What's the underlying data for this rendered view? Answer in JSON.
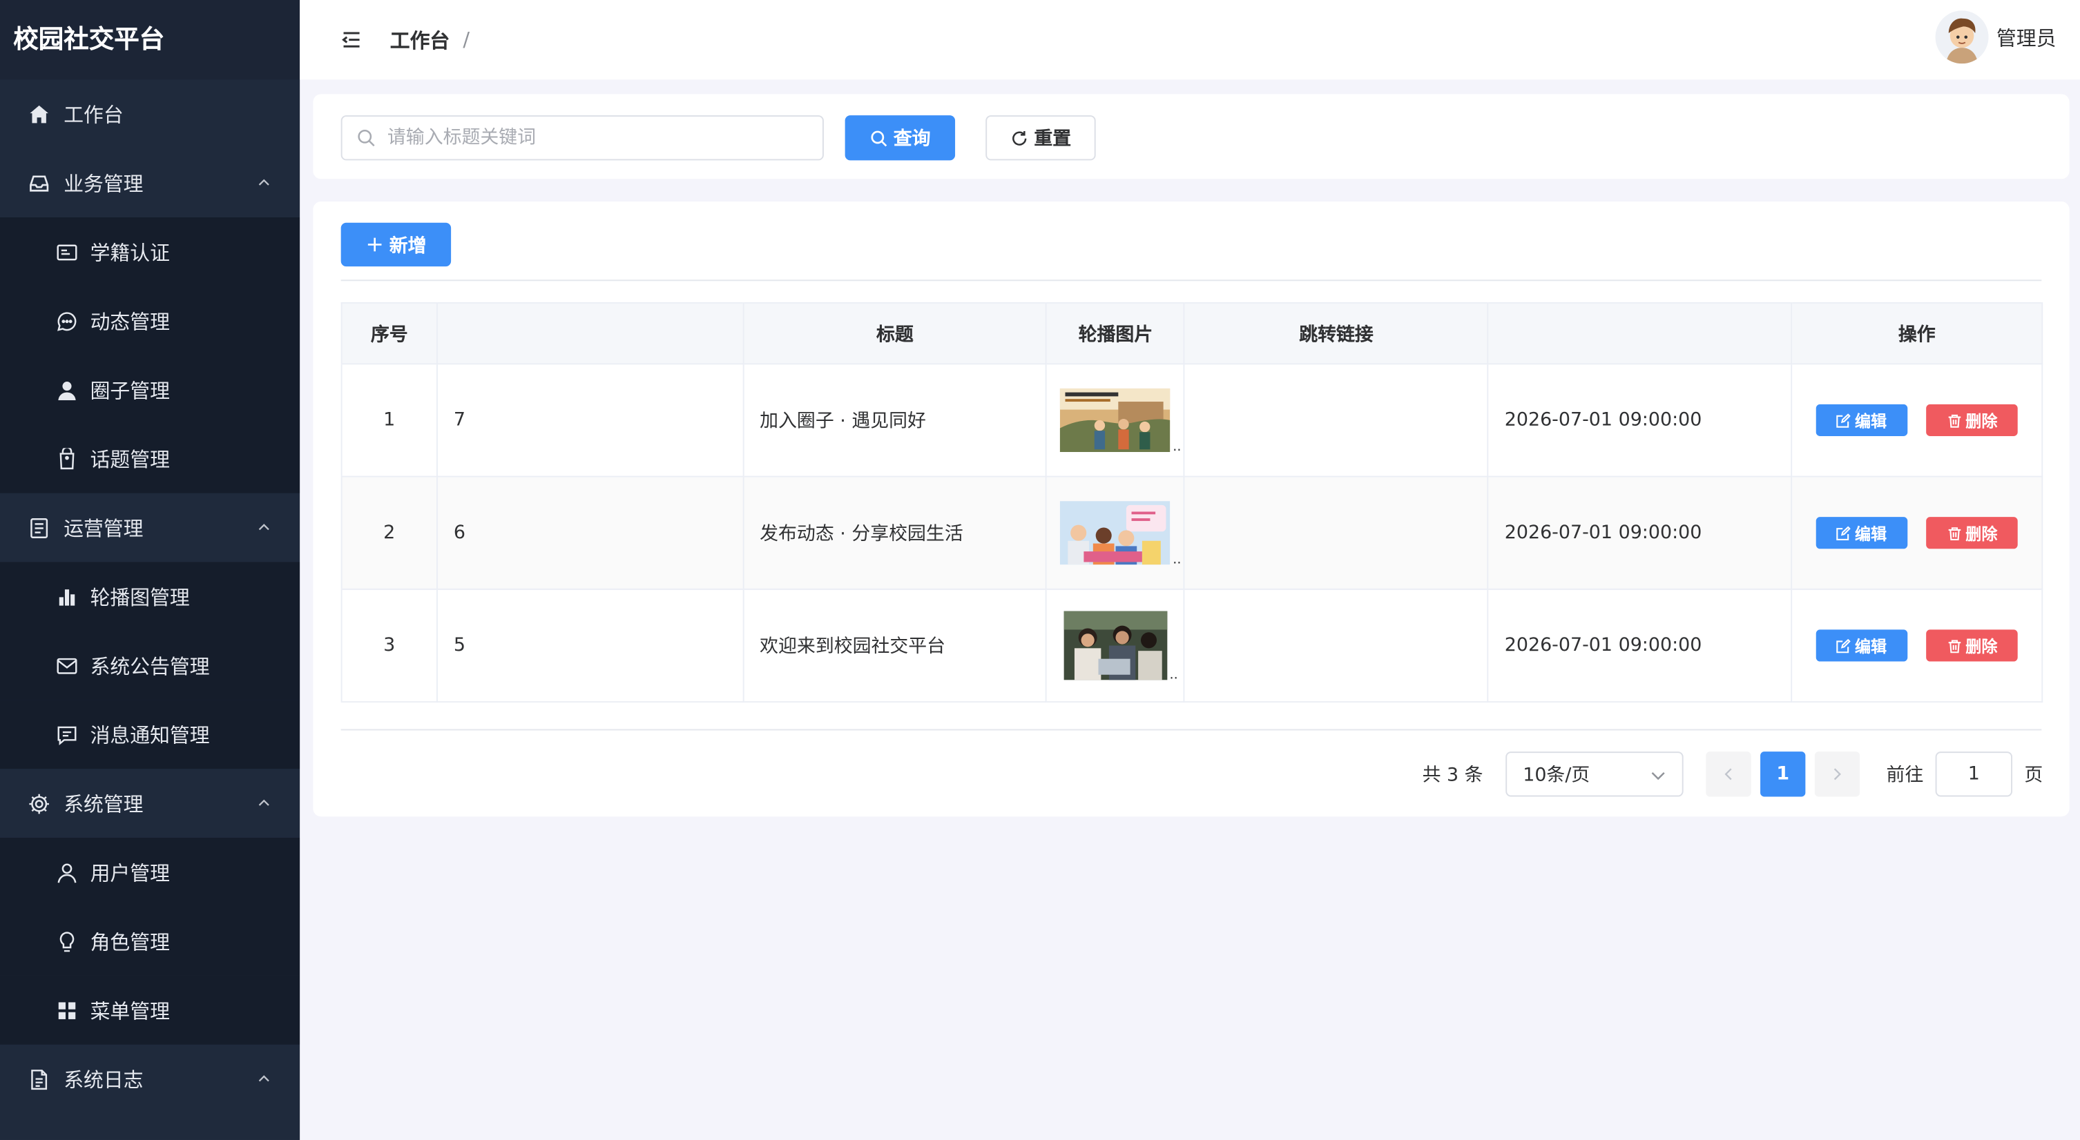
{
  "app": {
    "brand": "校园社交平台"
  },
  "sidebar": {
    "items": [
      {
        "label": "工作台",
        "icon": "home-icon"
      },
      {
        "label": "业务管理",
        "icon": "inbox-icon",
        "expanded": true
      },
      {
        "label": "学籍认证",
        "icon": "id-card-icon"
      },
      {
        "label": "动态管理",
        "icon": "chat-bubble-icon"
      },
      {
        "label": "圈子管理",
        "icon": "user-icon"
      },
      {
        "label": "话题管理",
        "icon": "tag-icon"
      },
      {
        "label": "运营管理",
        "icon": "document-icon",
        "expanded": true
      },
      {
        "label": "轮播图管理",
        "icon": "bar-chart-icon"
      },
      {
        "label": "系统公告管理",
        "icon": "mail-icon"
      },
      {
        "label": "消息通知管理",
        "icon": "message-icon"
      },
      {
        "label": "系统管理",
        "icon": "gear-icon",
        "expanded": true
      },
      {
        "label": "用户管理",
        "icon": "user-outline-icon"
      },
      {
        "label": "角色管理",
        "icon": "lightbulb-icon"
      },
      {
        "label": "菜单管理",
        "icon": "grid-icon"
      },
      {
        "label": "系统日志",
        "icon": "log-document-icon",
        "expanded": true
      }
    ]
  },
  "header": {
    "breadcrumb": "工作台",
    "separator": "/",
    "username": "管理员"
  },
  "search": {
    "placeholder": "请输入标题关键词",
    "value": "",
    "query_label": "查询",
    "reset_label": "重置"
  },
  "toolbar": {
    "add_label": "新增"
  },
  "table": {
    "columns": [
      "序号",
      "",
      "标题",
      "轮播图片",
      "跳转链接",
      "",
      "操作"
    ],
    "rows": [
      {
        "index": "1",
        "id": "7",
        "title": "加入圈子 · 遇见同好",
        "link": "",
        "time": "2026-07-01 09:00:00"
      },
      {
        "index": "2",
        "id": "6",
        "title": "发布动态 · 分享校园生活",
        "link": "",
        "time": "2026-07-01 09:00:00"
      },
      {
        "index": "3",
        "id": "5",
        "title": "欢迎来到校园社交平台",
        "link": "",
        "time": "2026-07-01 09:00:00"
      }
    ],
    "edit_label": "编辑",
    "delete_label": "删除",
    "thumb_ellipsis": ".."
  },
  "pagination": {
    "total_text": "共 3 条",
    "page_size": "10条/页",
    "current_page": "1",
    "goto_label": "前往",
    "goto_value": "1",
    "page_suffix": "页"
  },
  "colors": {
    "primary": "#3c8ff8",
    "danger": "#f05a5f",
    "sidebar_bg": "#1f2a3c"
  }
}
